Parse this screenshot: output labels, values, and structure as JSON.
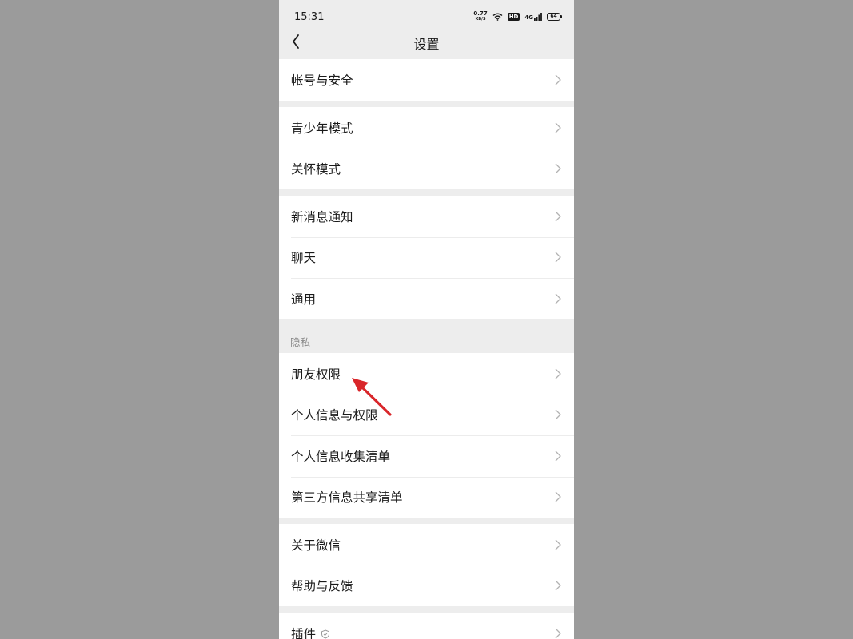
{
  "status_bar": {
    "time": "15:31",
    "net_speed_value": "0.77",
    "net_speed_unit": "KB/S",
    "hd_label": "HD",
    "signal_label": "4G",
    "battery": "64"
  },
  "nav": {
    "title": "设置"
  },
  "groups": [
    {
      "items": [
        {
          "label": "帐号与安全"
        }
      ]
    },
    {
      "items": [
        {
          "label": "青少年模式"
        },
        {
          "label": "关怀模式"
        }
      ]
    },
    {
      "items": [
        {
          "label": "新消息通知"
        },
        {
          "label": "聊天"
        },
        {
          "label": "通用"
        }
      ]
    },
    {
      "header": "隐私",
      "items": [
        {
          "label": "朋友权限"
        },
        {
          "label": "个人信息与权限"
        },
        {
          "label": "个人信息收集清单"
        },
        {
          "label": "第三方信息共享清单"
        }
      ]
    },
    {
      "items": [
        {
          "label": "关于微信"
        },
        {
          "label": "帮助与反馈"
        }
      ]
    },
    {
      "items": [
        {
          "label": "插件"
        }
      ]
    }
  ],
  "colors": {
    "background_outer": "#9b9b9b",
    "page_background": "#ededed",
    "row_background": "#ffffff",
    "annotation_arrow": "#d9262a"
  },
  "icons": {
    "back": "chevron-left-icon",
    "row_arrow": "chevron-right-icon",
    "plugin_badge": "shield-icon"
  }
}
